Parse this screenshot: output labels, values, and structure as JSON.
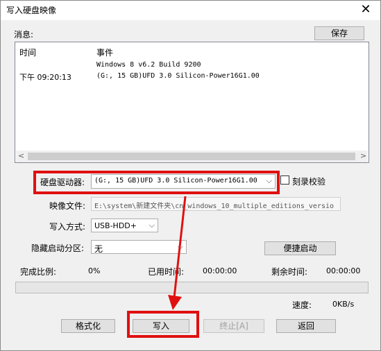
{
  "window": {
    "title": "写入硬盘映像",
    "close_glyph": "✕"
  },
  "messages": {
    "label": "消息:",
    "save_label": "保存",
    "col_time": "时间",
    "col_event": "事件",
    "rows": [
      {
        "time": "",
        "event": "Windows 8 v6.2 Build 9200"
      },
      {
        "time": "下午 09:20:13",
        "event": "(G:, 15 GB)UFD 3.0 Silicon-Power16G1.00"
      }
    ]
  },
  "drive": {
    "label": "硬盘驱动器:",
    "value": "(G:, 15 GB)UFD 3.0 Silicon-Power16G1.00",
    "verify_label": "刻录校验"
  },
  "image_file": {
    "label": "映像文件:",
    "value": "E:\\system\\新建文件夹\\cn_windows_10_multiple_editions_versio"
  },
  "write_method": {
    "label": "写入方式:",
    "value": "USB-HDD+"
  },
  "hidden_partition": {
    "label": "隐藏启动分区:",
    "value": "无"
  },
  "quick_boot_label": "便捷启动",
  "progress": {
    "done_label": "完成比例:",
    "done_value": "0%",
    "elapsed_label": "已用时间:",
    "elapsed_value": "00:00:00",
    "remain_label": "剩余时间:",
    "remain_value": "00:00:00",
    "percent": 0,
    "speed_label": "速度:",
    "speed_value": "0KB/s"
  },
  "buttons": {
    "format": "格式化",
    "write": "写入",
    "stop": "终止[A]",
    "back": "返回"
  },
  "annotation": {
    "color": "#e01010"
  }
}
